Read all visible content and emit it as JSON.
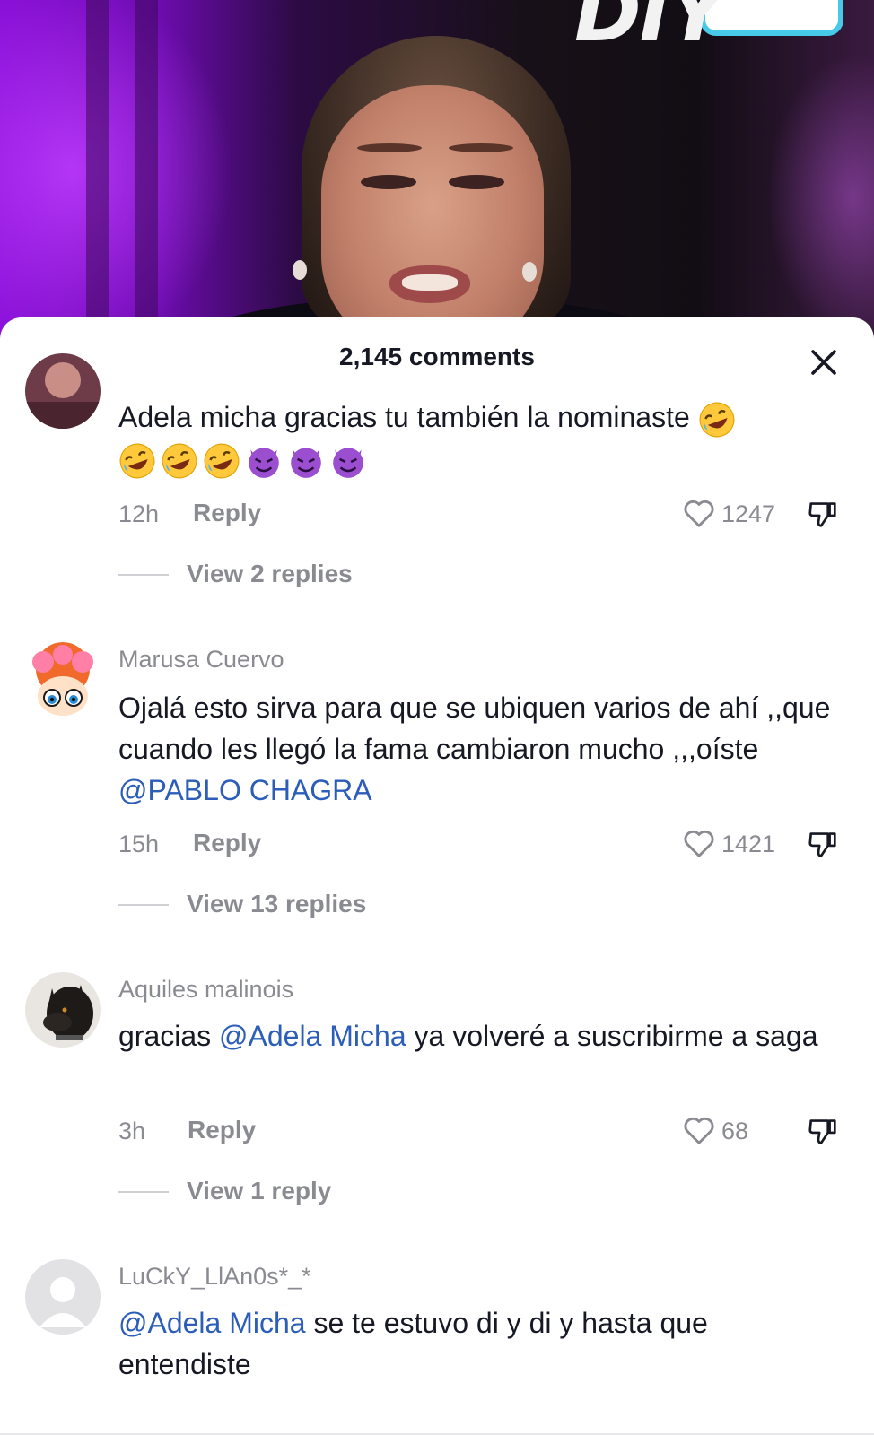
{
  "sheet": {
    "title": "2,145 comments",
    "close_icon": "close-icon"
  },
  "comments": [
    {
      "username": "",
      "text": "Adela micha gracias tu también la nominaste",
      "emojis": [
        "rolling-on-floor-laughing",
        "rolling-on-floor-laughing",
        "rolling-on-floor-laughing",
        "rolling-on-floor-laughing",
        "smiling-devil",
        "smiling-devil",
        "smiling-devil"
      ],
      "time": "12h",
      "reply_label": "Reply",
      "likes": "1247",
      "view_replies": "View 2 replies"
    },
    {
      "username": "Marusa Cuervo",
      "text_before": "Ojalá esto sirva para que se ubiquen varios de ahí ,,que cuando les llegó la fama cambiaron mucho ,,,oíste ",
      "mention": "@PABLO CHAGRA",
      "time": "15h",
      "reply_label": "Reply",
      "likes": "1421",
      "view_replies": "View 13 replies"
    },
    {
      "username": "Aquiles malinois",
      "text_before": "gracias ",
      "mention": "@Adela Micha",
      "text_after": " ya volveré a suscribirme a saga",
      "time": "3h",
      "reply_label": "Reply",
      "likes": "68",
      "view_replies": "View 1 reply"
    },
    {
      "username": "LuCkY_LlAn0s*_*",
      "mention": "@Adela Micha",
      "text_after": " se te estuvo di y di y hasta que entendiste"
    }
  ],
  "colors": {
    "mention": "#2b5db9",
    "muted": "#8a8b91",
    "text": "#161823"
  }
}
